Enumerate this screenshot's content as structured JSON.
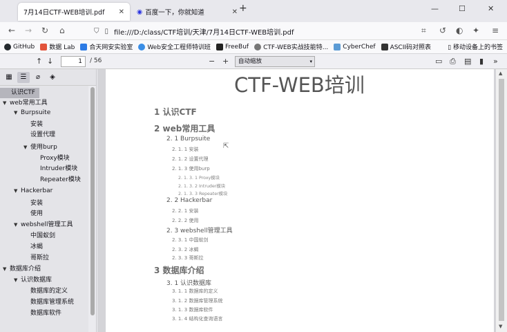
{
  "tabs": [
    {
      "title": "7月14日CTF-WEB培训.pdf",
      "active": true
    },
    {
      "title": "百度一下，你就知道",
      "active": false
    }
  ],
  "new_tab": "+",
  "window_controls": {
    "minimize": "—",
    "maximize": "☐",
    "close": "✕"
  },
  "address": {
    "url": "file:///D:/class/CTF培训/天津/7月14日CTF-WEB培训.pdf"
  },
  "bookmarks": [
    {
      "label": "GitHub",
      "color": "#24292e"
    },
    {
      "label": "数据 Lab",
      "color": "#e2533b"
    },
    {
      "label": "合天网安实验室",
      "color": "#2c7be5"
    },
    {
      "label": "Web安全工程师特训班",
      "color": "#3a8ee6"
    },
    {
      "label": "FreeBuf",
      "color": "#222"
    },
    {
      "label": "CTF-WEB实战技能特...",
      "color": "#777"
    },
    {
      "label": "CyberChef",
      "color": "#5b9bd5"
    },
    {
      "label": "ASCII码对照表",
      "color": "#333"
    }
  ],
  "bookmark_mobile": "移动设备上的书签",
  "pdf_toolbar": {
    "page_current": "1",
    "page_total": "/ 56",
    "zoom": "自动缩放"
  },
  "outline": [
    {
      "label": "认识CTF",
      "level": 0,
      "twisty": "",
      "selected": true
    },
    {
      "label": "web常用工具",
      "level": 0,
      "twisty": "▼"
    },
    {
      "label": "Burpsuite",
      "level": 1,
      "twisty": "▼"
    },
    {
      "label": "安装",
      "level": 2,
      "twisty": ""
    },
    {
      "label": "设置代理",
      "level": 2,
      "twisty": ""
    },
    {
      "label": "使用burp",
      "level": 2,
      "twisty": "▼"
    },
    {
      "label": "Proxy模块",
      "level": 3,
      "twisty": ""
    },
    {
      "label": "Intruder模块",
      "level": 3,
      "twisty": ""
    },
    {
      "label": "Repeater模块",
      "level": 3,
      "twisty": ""
    },
    {
      "label": "Hackerbar",
      "level": 1,
      "twisty": "▼"
    },
    {
      "label": "安装",
      "level": 2,
      "twisty": ""
    },
    {
      "label": "使用",
      "level": 2,
      "twisty": ""
    },
    {
      "label": "webshell管理工具",
      "level": 1,
      "twisty": "▼"
    },
    {
      "label": "中国蚁剑",
      "level": 2,
      "twisty": ""
    },
    {
      "label": "冰蝎",
      "level": 2,
      "twisty": ""
    },
    {
      "label": "哥斯拉",
      "level": 2,
      "twisty": ""
    },
    {
      "label": "数据库介绍",
      "level": 0,
      "twisty": "▼"
    },
    {
      "label": "认识数据库",
      "level": 1,
      "twisty": "▼"
    },
    {
      "label": "数据库的定义",
      "level": 2,
      "twisty": ""
    },
    {
      "label": "数据库管理系统",
      "level": 2,
      "twisty": ""
    },
    {
      "label": "数据库软件",
      "level": 2,
      "twisty": ""
    }
  ],
  "document": {
    "title": "CTF-WEB培训",
    "toc": [
      {
        "text": "1 认识CTF",
        "cls": "h1"
      },
      {
        "text": "2 web常用工具",
        "cls": "h1"
      },
      {
        "text": "2. 1 Burpsuite",
        "cls": "h2"
      },
      {
        "text": "2. 1. 1 安装",
        "cls": "h3"
      },
      {
        "text": "2. 1. 2 设置代理",
        "cls": "h3"
      },
      {
        "text": "2. 1. 3 使用burp",
        "cls": "h3"
      },
      {
        "text": "2. 1. 3. 1 Proxy模块",
        "cls": "h4"
      },
      {
        "text": "2. 1. 3. 2 Intruder模块",
        "cls": "h4"
      },
      {
        "text": "2. 1. 3. 3 Repeater模块",
        "cls": "h4"
      },
      {
        "text": "2. 2 Hackerbar",
        "cls": "h2"
      },
      {
        "text": "2. 2. 1 安装",
        "cls": "h3"
      },
      {
        "text": "2. 2. 2 使用",
        "cls": "h3"
      },
      {
        "text": "2. 3 webshell管理工具",
        "cls": "h2"
      },
      {
        "text": "2. 3. 1 中国蚁剑",
        "cls": "h3"
      },
      {
        "text": "2. 3. 2 冰蝎",
        "cls": "h3"
      },
      {
        "text": "2. 3. 3 哥斯拉",
        "cls": "h3"
      },
      {
        "text": "3 数据库介绍",
        "cls": "h1"
      },
      {
        "text": "3. 1 认识数据库",
        "cls": "h2"
      },
      {
        "text": "3. 1. 1 数据库的定义",
        "cls": "h3"
      },
      {
        "text": "3. 1. 2 数据库管理系统",
        "cls": "h3"
      },
      {
        "text": "3. 1. 3 数据库软件",
        "cls": "h3"
      },
      {
        "text": "3. 1. 4 结构化查询语言",
        "cls": "h3"
      }
    ]
  }
}
